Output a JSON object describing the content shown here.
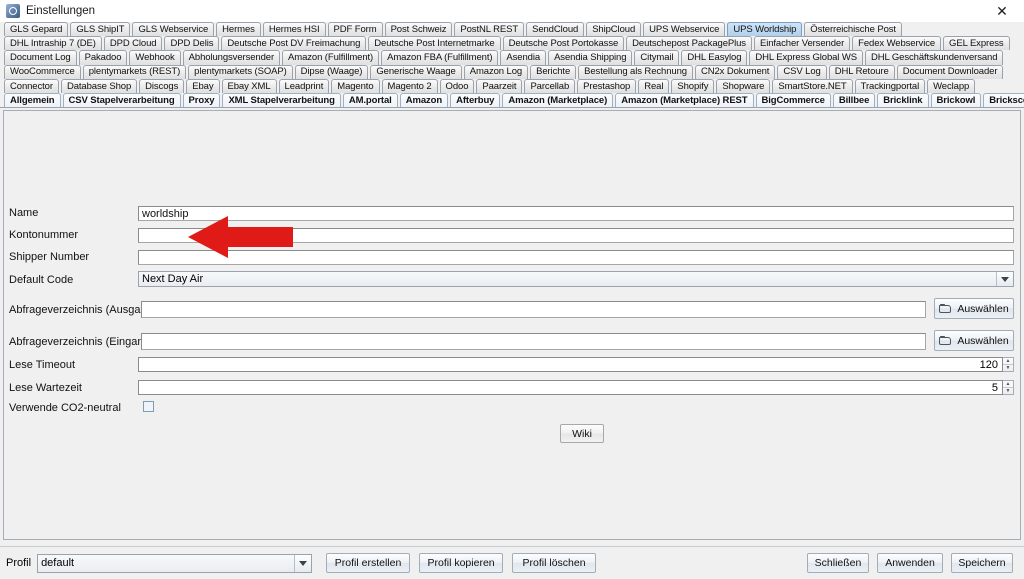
{
  "window": {
    "title": "Einstellungen",
    "app_icon": "settings-app-icon",
    "close_label": "✕"
  },
  "tabs": {
    "selected": "UPS Worldship",
    "rows": [
      [
        "GLS Gepard",
        "GLS ShipIT",
        "GLS Webservice",
        "Hermes",
        "Hermes HSI",
        "PDF Form",
        "Post Schweiz",
        "PostNL REST",
        "SendCloud",
        "ShipCloud",
        "UPS Webservice",
        "UPS Worldship",
        "Österreichische Post"
      ],
      [
        "DHL Intraship 7 (DE)",
        "DPD Cloud",
        "DPD Delis",
        "Deutsche Post DV Freimachung",
        "Deutsche Post Internetmarke",
        "Deutsche Post Portokasse",
        "Deutschepost PackagePlus",
        "Einfacher Versender",
        "Fedex Webservice",
        "GEL Express"
      ],
      [
        "Document Log",
        "Pakadoo",
        "Webhook",
        "Abholungsversender",
        "Amazon (Fulfillment)",
        "Amazon FBA (Fulfillment)",
        "Asendia",
        "Asendia Shipping",
        "Citymail",
        "DHL Easylog",
        "DHL Express Global WS",
        "DHL Geschäftskundenversand"
      ],
      [
        "WooCommerce",
        "plentymarkets (REST)",
        "plentymarkets (SOAP)",
        "Dipse (Waage)",
        "Generische Waage",
        "Amazon Log",
        "Berichte",
        "Bestellung als Rechnung",
        "CN2x Dokument",
        "CSV Log",
        "DHL Retoure",
        "Document Downloader"
      ],
      [
        "Connector",
        "Database Shop",
        "Discogs",
        "Ebay",
        "Ebay XML",
        "Leadprint",
        "Magento",
        "Magento 2",
        "Odoo",
        "Paarzeit",
        "Parcellab",
        "Prestashop",
        "Real",
        "Shopify",
        "Shopware",
        "SmartStore.NET",
        "Trackingportal",
        "Weclapp"
      ],
      [
        "Allgemein",
        "CSV Stapelverarbeitung",
        "Proxy",
        "XML Stapelverarbeitung",
        "AM.portal",
        "Amazon",
        "Afterbuy",
        "Amazon (Marketplace)",
        "Amazon (Marketplace) REST",
        "BigCommerce",
        "Billbee",
        "Bricklink",
        "Brickowl",
        "Brickscout"
      ]
    ]
  },
  "form": {
    "fields": [
      {
        "label": "Name",
        "value": "worldship",
        "placeholder": ""
      },
      {
        "label": "Kontonummer",
        "value": "",
        "placeholder": ""
      },
      {
        "label": "Shipper Number",
        "value": "",
        "placeholder": ""
      }
    ],
    "default_code": {
      "label": "Default Code",
      "value": "Next Day Air"
    },
    "directories": [
      {
        "label": "Abfrageverzeichnis (Ausgang)",
        "value": "",
        "button": "Auswählen",
        "icon": "folder-icon"
      },
      {
        "label": "Abfrageverzeichnis (Eingang)",
        "value": "",
        "button": "Auswählen",
        "icon": "folder-icon"
      }
    ],
    "spinners": [
      {
        "label": "Lese Timeout",
        "value": "120"
      },
      {
        "label": "Lese Wartezeit",
        "value": "5"
      }
    ],
    "checkbox": {
      "label": "Verwende CO2-neutral",
      "checked": false
    },
    "wiki_button": "Wiki"
  },
  "annotation": {
    "arrow": "red-left-arrow",
    "color": "#e01b17"
  },
  "bottom": {
    "profile_label": "Profil",
    "profile_value": "default",
    "buttons_left": [
      "Profil erstellen",
      "Profil kopieren",
      "Profil löschen"
    ],
    "buttons_right": [
      "Schließen",
      "Anwenden",
      "Speichern"
    ]
  }
}
